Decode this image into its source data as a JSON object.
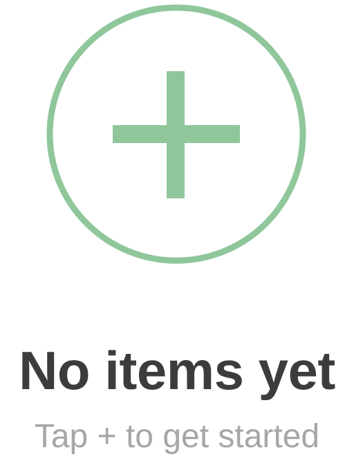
{
  "empty_state": {
    "icon": "plus-circle-icon",
    "accent_color": "#8fc79b",
    "title": "No items yet",
    "subtitle": "Tap + to get started"
  }
}
